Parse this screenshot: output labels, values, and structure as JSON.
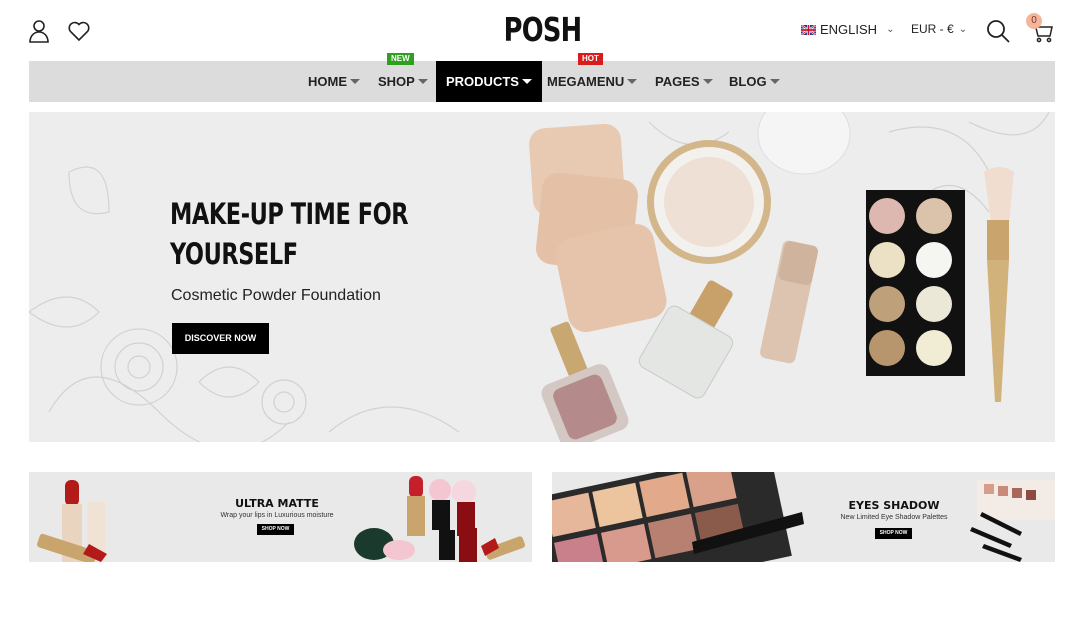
{
  "header": {
    "logo": "POSH",
    "language": "ENGLISH",
    "currency": "EUR - €",
    "cart_count": "0",
    "icons": [
      "user-icon",
      "heart-icon",
      "search-icon",
      "cart-icon",
      "uk-flag-icon"
    ]
  },
  "nav": {
    "items": [
      {
        "label": "HOME",
        "badge": ""
      },
      {
        "label": "SHOP",
        "badge": "NEW"
      },
      {
        "label": "PRODUCTS",
        "badge": ""
      },
      {
        "label": "MEGAMENU",
        "badge": "HOT"
      },
      {
        "label": "PAGES",
        "badge": ""
      },
      {
        "label": "BLOG",
        "badge": ""
      }
    ],
    "active": "PRODUCTS",
    "colors": {
      "new_badge": "#2e9f1f",
      "hot_badge": "#d81c1c",
      "active_bg": "#000000",
      "bar_bg": "#dcdcdc"
    }
  },
  "hero": {
    "title_line1": "MAKE-UP TIME FOR",
    "title_line2": "YOURSELF",
    "subtitle": "Cosmetic Powder Foundation",
    "button": "DISCOVER NOW"
  },
  "promos": [
    {
      "title": "ULTRA MATTE",
      "subtitle": "Wrap your lips in Luxurious moisture",
      "button": "SHOP NOW"
    },
    {
      "title": "EYES SHADOW",
      "subtitle": "New Limited Eye Shadow Palettes",
      "button": "SHOP NOW"
    }
  ]
}
